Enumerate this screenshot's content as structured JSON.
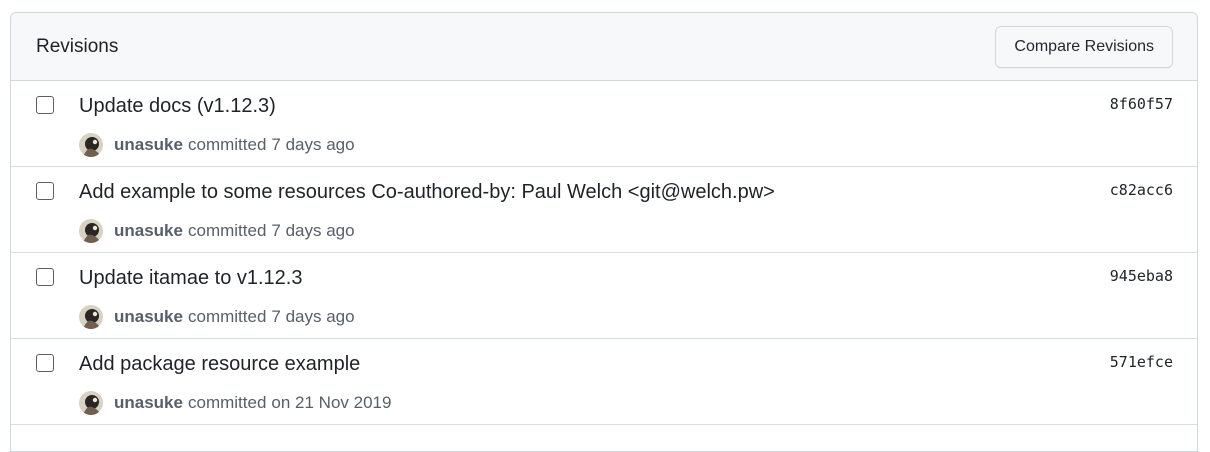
{
  "header": {
    "title": "Revisions",
    "compare_label": "Compare Revisions"
  },
  "revisions": [
    {
      "title": "Update docs (v1.12.3)",
      "sha": "8f60f57",
      "author": "unasuke",
      "committed": "committed",
      "date": "7 days ago"
    },
    {
      "title": "Add example to some resources Co-authored-by: Paul Welch <git@welch.pw>",
      "sha": "c82acc6",
      "author": "unasuke",
      "committed": "committed",
      "date": "7 days ago"
    },
    {
      "title": "Update itamae to v1.12.3",
      "sha": "945eba8",
      "author": "unasuke",
      "committed": "committed",
      "date": "7 days ago"
    },
    {
      "title": "Add package resource example",
      "sha": "571efce",
      "author": "unasuke",
      "committed": "committed",
      "date": "on 21 Nov 2019"
    }
  ]
}
